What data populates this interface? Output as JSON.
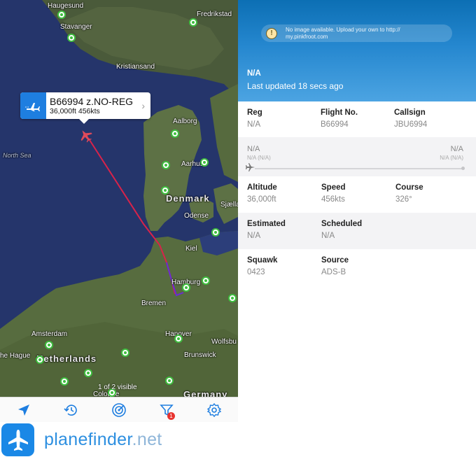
{
  "map": {
    "places": {
      "haugesund": "Haugesund",
      "stavanger": "Stavanger",
      "kristiansand": "Kristiansand",
      "frederikstad": "Fredrikstad",
      "north_sea": "North Sea",
      "aalborg": "Aalborg",
      "aarhus": "Aarhus",
      "denmark": "Denmark",
      "odense": "Odense",
      "sjaelland": "Sjælla",
      "kiel": "Kiel",
      "hamburg": "Hamburg",
      "bremen": "Bremen",
      "amsterdam": "Amsterdam",
      "hanover": "Hanover",
      "wolfsburg": "Wolfsbu",
      "the_hague": "he Hague",
      "netherlands": "Netherlands",
      "brunswick": "Brunswick",
      "cologne": "Cologne",
      "germany": "Germany"
    },
    "callout": {
      "title": "B66994 z.NO-REG",
      "subtitle": "36,000ft 456kts"
    },
    "visible_count": "1 of 2 visible",
    "track_color": "#d8234a",
    "track_end_color": "#6a2bd6"
  },
  "tabbar": {
    "tabs": [
      {
        "icon": "location-arrow-icon"
      },
      {
        "icon": "history-icon"
      },
      {
        "icon": "radar-icon"
      },
      {
        "icon": "filter-icon",
        "badge": "1"
      },
      {
        "icon": "gear-icon"
      }
    ]
  },
  "brand": {
    "name": "planefinder",
    "tld": ".net"
  },
  "panel": {
    "no_image": "No image available. Upload your own to http://\nmy.pinkfroot.com",
    "registration": "N/A",
    "last_updated": "Last updated 18 secs ago",
    "fields": {
      "reg_label": "Reg",
      "reg_value": "N/A",
      "flight_label": "Flight No.",
      "flight_value": "B66994",
      "callsign_label": "Callsign",
      "callsign_value": "JBU6994",
      "altitude_label": "Altitude",
      "altitude_value": "36,000ft",
      "speed_label": "Speed",
      "speed_value": "456kts",
      "course_label": "Course",
      "course_value": "326°",
      "estimated_label": "Estimated",
      "estimated_value": "N/A",
      "scheduled_label": "Scheduled",
      "scheduled_value": "N/A",
      "squawk_label": "Squawk",
      "squawk_value": "0423",
      "source_label": "Source",
      "source_value": "ADS-B"
    },
    "route": {
      "origin": "N/A",
      "origin_sub": "N/A (N/A)",
      "destination": "N/A",
      "destination_sub": "N/A (N/A)"
    }
  }
}
